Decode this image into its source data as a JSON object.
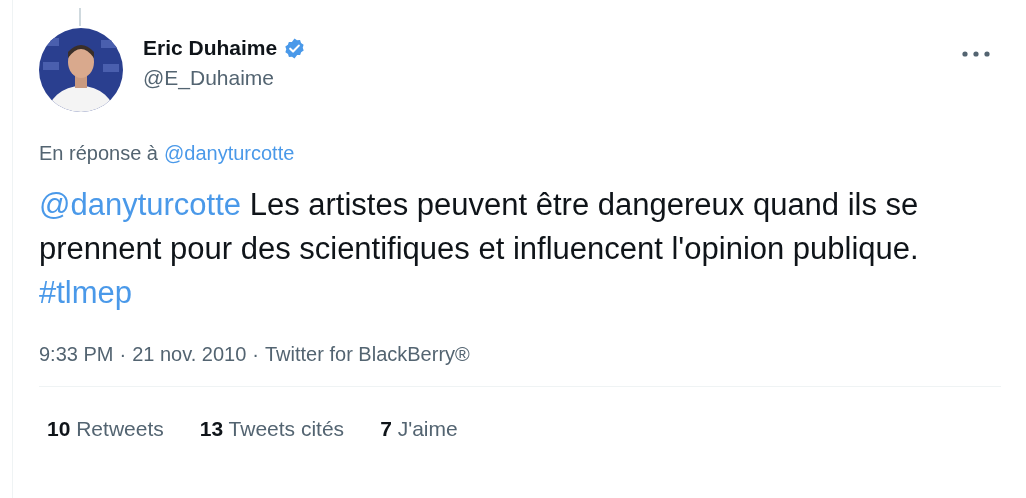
{
  "author": {
    "name": "Eric Duhaime",
    "verified": true,
    "handle": "@E_Duhaime"
  },
  "reply_to": {
    "prefix": "En réponse à",
    "mention": "@danyturcotte"
  },
  "tweet": {
    "segments": [
      {
        "kind": "mention",
        "text": "@danyturcotte"
      },
      {
        "kind": "text",
        "text": " Les artistes peuvent être dangereux quand ils se prennent pour des scientifiques et influencent l'opinion publique. "
      },
      {
        "kind": "hashtag",
        "text": "#tlmep"
      }
    ]
  },
  "meta": {
    "time": "9:33 PM",
    "date": "21 nov. 2010",
    "source": "Twitter for BlackBerry®",
    "separator": "·"
  },
  "stats": [
    {
      "count": "10",
      "label": "Retweets"
    },
    {
      "count": "13",
      "label": "Tweets cités"
    },
    {
      "count": "7",
      "label": "J'aime"
    }
  ]
}
